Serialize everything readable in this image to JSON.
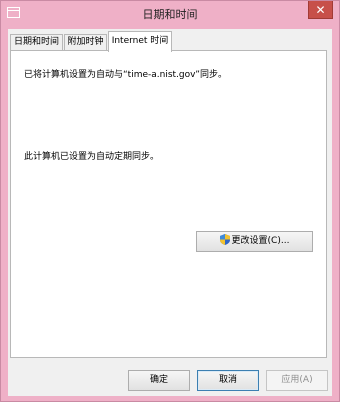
{
  "window": {
    "title": "日期和时间",
    "close_glyph": "✕"
  },
  "tabs": [
    {
      "label": "日期和时间",
      "active": false
    },
    {
      "label": "附加时钟",
      "active": false
    },
    {
      "label": "Internet 时间",
      "active": true
    }
  ],
  "panel": {
    "sync_message": "已将计算机设置为自动与“time-a.nist.gov”同步。",
    "schedule_message": "此计算机已设置为自动定期同步。",
    "change_settings_label": "更改设置(C)...",
    "change_settings_icon": "uac-shield-icon"
  },
  "footer": {
    "ok_label": "确定",
    "cancel_label": "取消",
    "apply_label": "应用(A)"
  },
  "colors": {
    "window_frame": "#efb0c7",
    "close_button": "#c7504a",
    "dialog_background": "#f0f0f0",
    "panel_background": "#ffffff"
  }
}
